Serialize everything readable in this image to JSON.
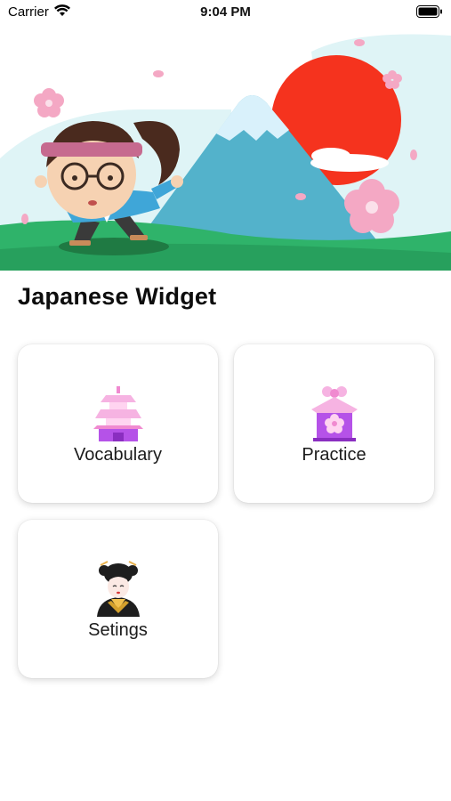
{
  "status_bar": {
    "carrier": "Carrier",
    "time": "9:04 PM"
  },
  "hero": {
    "description_icon": "mount-fuji-illustration"
  },
  "page_title": "Japanese Widget",
  "tiles": [
    {
      "label": "Vocabulary",
      "icon": "pagoda-icon"
    },
    {
      "label": "Practice",
      "icon": "temple-icon"
    },
    {
      "label": "Setings",
      "icon": "geisha-icon"
    }
  ],
  "colors": {
    "accent_purple": "#b552e8",
    "sun_red": "#f5331e",
    "grass_green": "#2fb36a",
    "mountain_blue": "#53b2cb",
    "sakura_pink": "#f4a8c4"
  }
}
